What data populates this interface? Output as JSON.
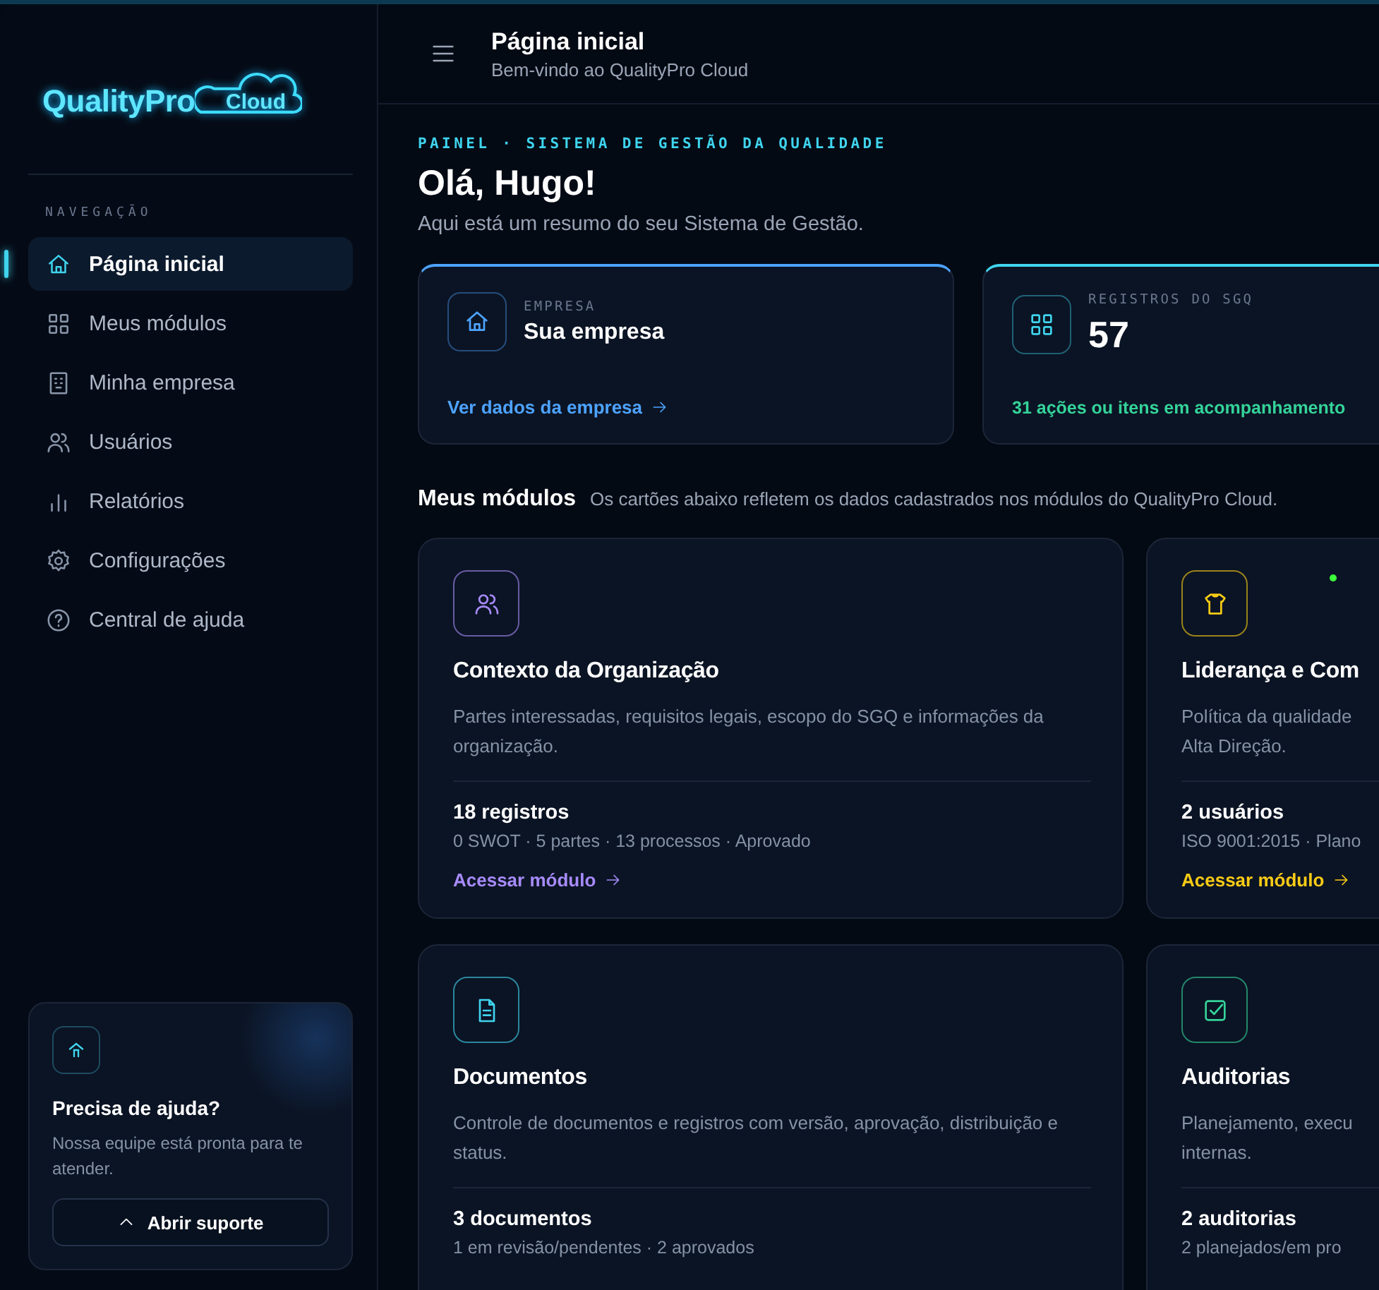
{
  "logo": {
    "text": "QualityPro",
    "badge": "Cloud"
  },
  "sidebar": {
    "section_label": "NAVEGAÇÃO",
    "items": [
      {
        "label": "Página inicial",
        "selected": true
      },
      {
        "label": "Meus módulos",
        "selected": false
      },
      {
        "label": "Minha empresa",
        "selected": false
      },
      {
        "label": "Usuários",
        "selected": false
      },
      {
        "label": "Relatórios",
        "selected": false
      },
      {
        "label": "Configurações",
        "selected": false
      },
      {
        "label": "Central de ajuda",
        "selected": false
      }
    ],
    "help_card": {
      "title": "Precisa de ajuda?",
      "text": "Nossa equipe está pronta para te atender.",
      "button": "Abrir suporte"
    }
  },
  "header": {
    "title": "Página inicial",
    "subtitle": "Bem-vindo ao QualityPro Cloud"
  },
  "eyebrow": "PAINEL · SISTEMA DE GESTÃO DA QUALIDADE",
  "greeting": "Olá, Hugo!",
  "intro": "Aqui está um resumo do seu Sistema de Gestão.",
  "stat_cards": [
    {
      "kind": "link",
      "label": "EMPRESA",
      "value": "Sua empresa",
      "color": "#4da3ff",
      "footer": "Ver dados da empresa"
    },
    {
      "kind": "number",
      "label": "REGISTROS DO SGQ",
      "value": "57",
      "color": "#3fd4ee",
      "footer": "31 ações ou itens em acompanhamento"
    }
  ],
  "modules_section": {
    "title": "Meus módulos",
    "subtitle": "Os cartões abaixo refletem os dados cadastrados nos módulos do QualityPro Cloud."
  },
  "modules": [
    {
      "color": "#a78bfa",
      "title": "Contexto da Organização",
      "description": "Partes interessadas, requisitos legais, escopo do SGQ e informações da organização.",
      "count": "18 registros",
      "meta": "0 SWOT · 5 partes · 13 processos · Aprovado",
      "link": "Acessar módulo",
      "status_dot": false
    },
    {
      "color": "#facc15",
      "title": "Liderança e Com",
      "description": "Política da qualidade\nAlta Direção.",
      "count": "2 usuários",
      "meta": "ISO 9001:2015 · Plano",
      "link": "Acessar módulo",
      "status_dot": true
    },
    {
      "color": "#3fd4ee",
      "title": "Documentos",
      "description": "Controle de documentos e registros com versão, aprovação, distribuição e status.",
      "count": "3 documentos",
      "meta": "1 em revisão/pendentes · 2 aprovados",
      "status_dot": false
    },
    {
      "color": "#34d399",
      "title": "Auditorias",
      "description": "Planejamento, execu\ninternas.",
      "count": "2 auditorias",
      "meta": "2 planejados/em pro",
      "status_dot": false
    }
  ]
}
